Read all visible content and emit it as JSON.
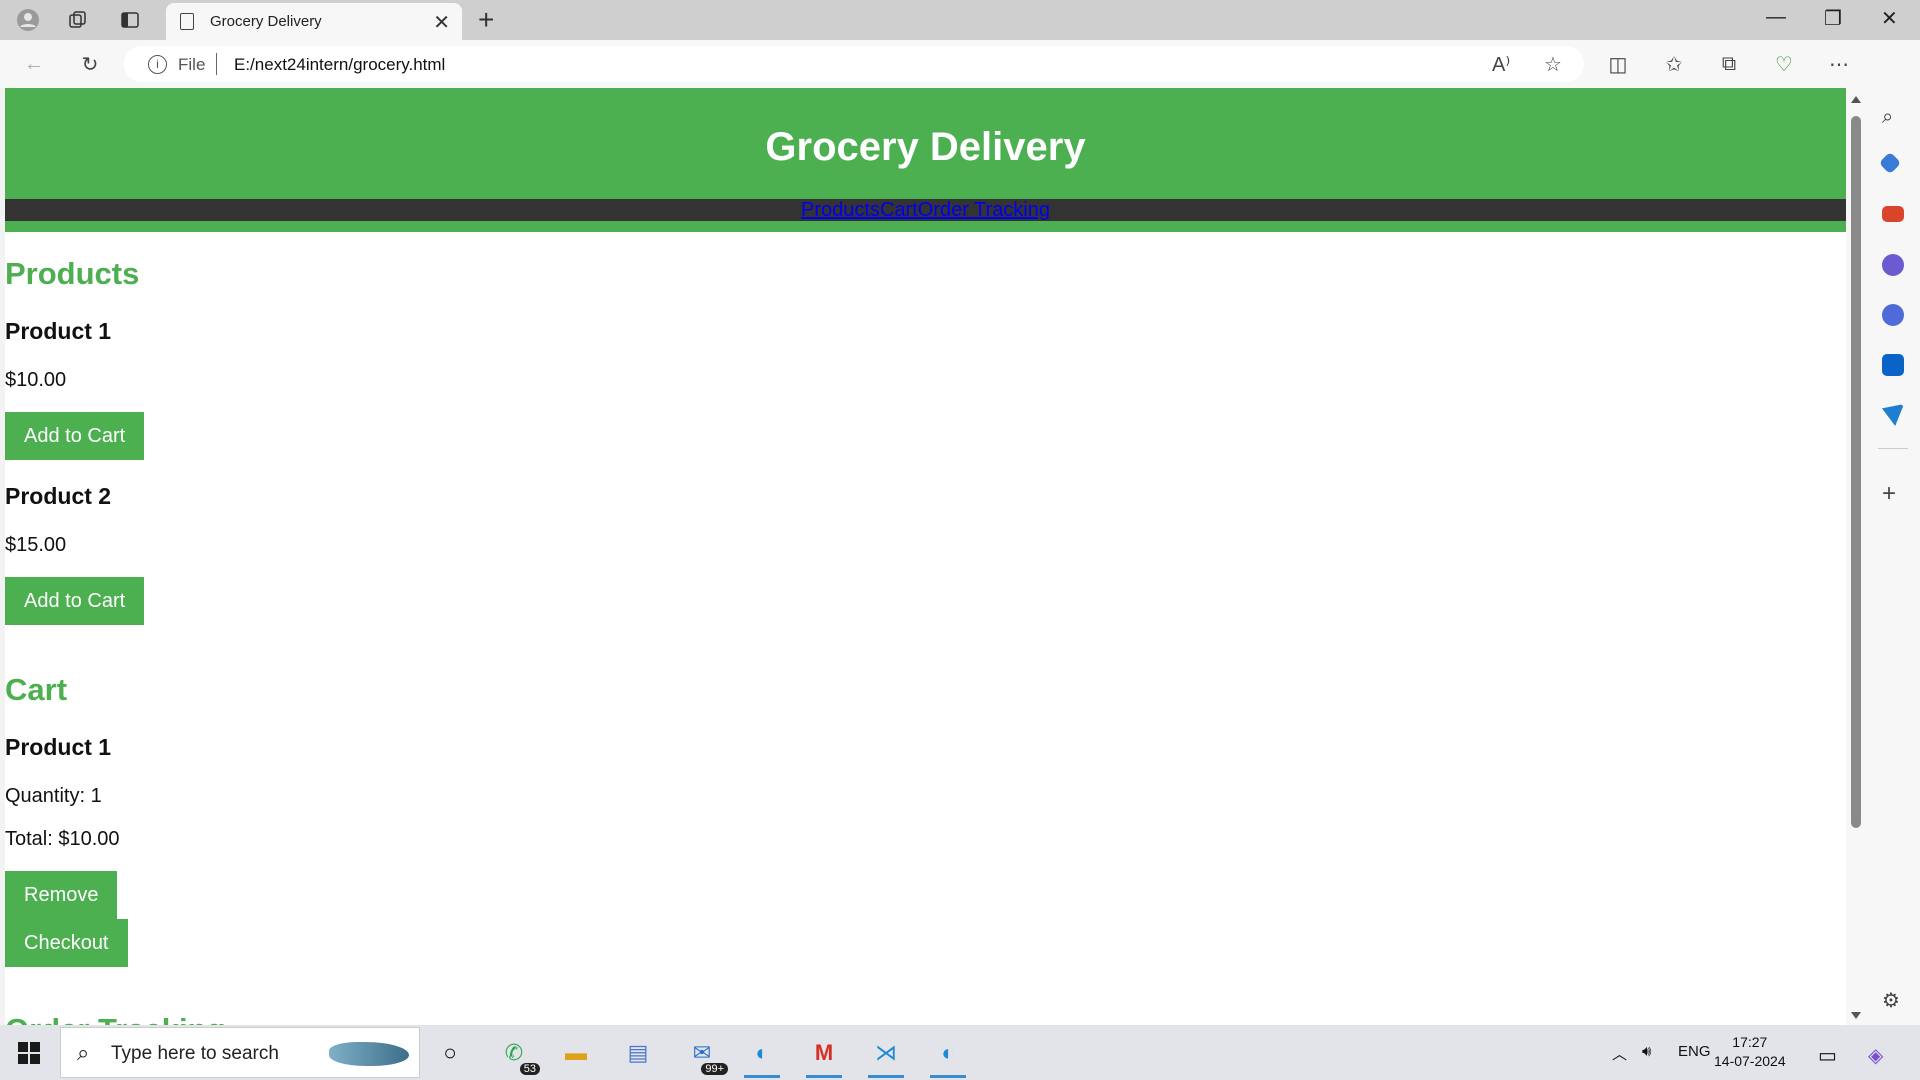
{
  "browser": {
    "tab_title": "Grocery Delivery",
    "address_protocol": "File",
    "address_url": "E:/next24intern/grocery.html"
  },
  "page": {
    "header_title": "Grocery Delivery",
    "nav": [
      "Products",
      "Cart",
      "Order Tracking"
    ],
    "products_heading": "Products",
    "products": [
      {
        "name": "Product 1",
        "price": "$10.00",
        "button": "Add to Cart"
      },
      {
        "name": "Product 2",
        "price": "$15.00",
        "button": "Add to Cart"
      }
    ],
    "cart_heading": "Cart",
    "cart_item": {
      "name": "Product 1",
      "quantity": "Quantity: 1",
      "total": "Total: $10.00",
      "remove_button": "Remove"
    },
    "checkout_button": "Checkout",
    "order_tracking_heading": "Order Tracking"
  },
  "taskbar": {
    "search_placeholder": "Type here to search",
    "whatsapp_badge": "53",
    "mail_badge": "99+",
    "language": "ENG",
    "time": "17:27",
    "date": "14-07-2024"
  },
  "colors": {
    "accent_green": "#4caf50",
    "nav_bg": "#333333",
    "link_blue": "#0000ee"
  }
}
